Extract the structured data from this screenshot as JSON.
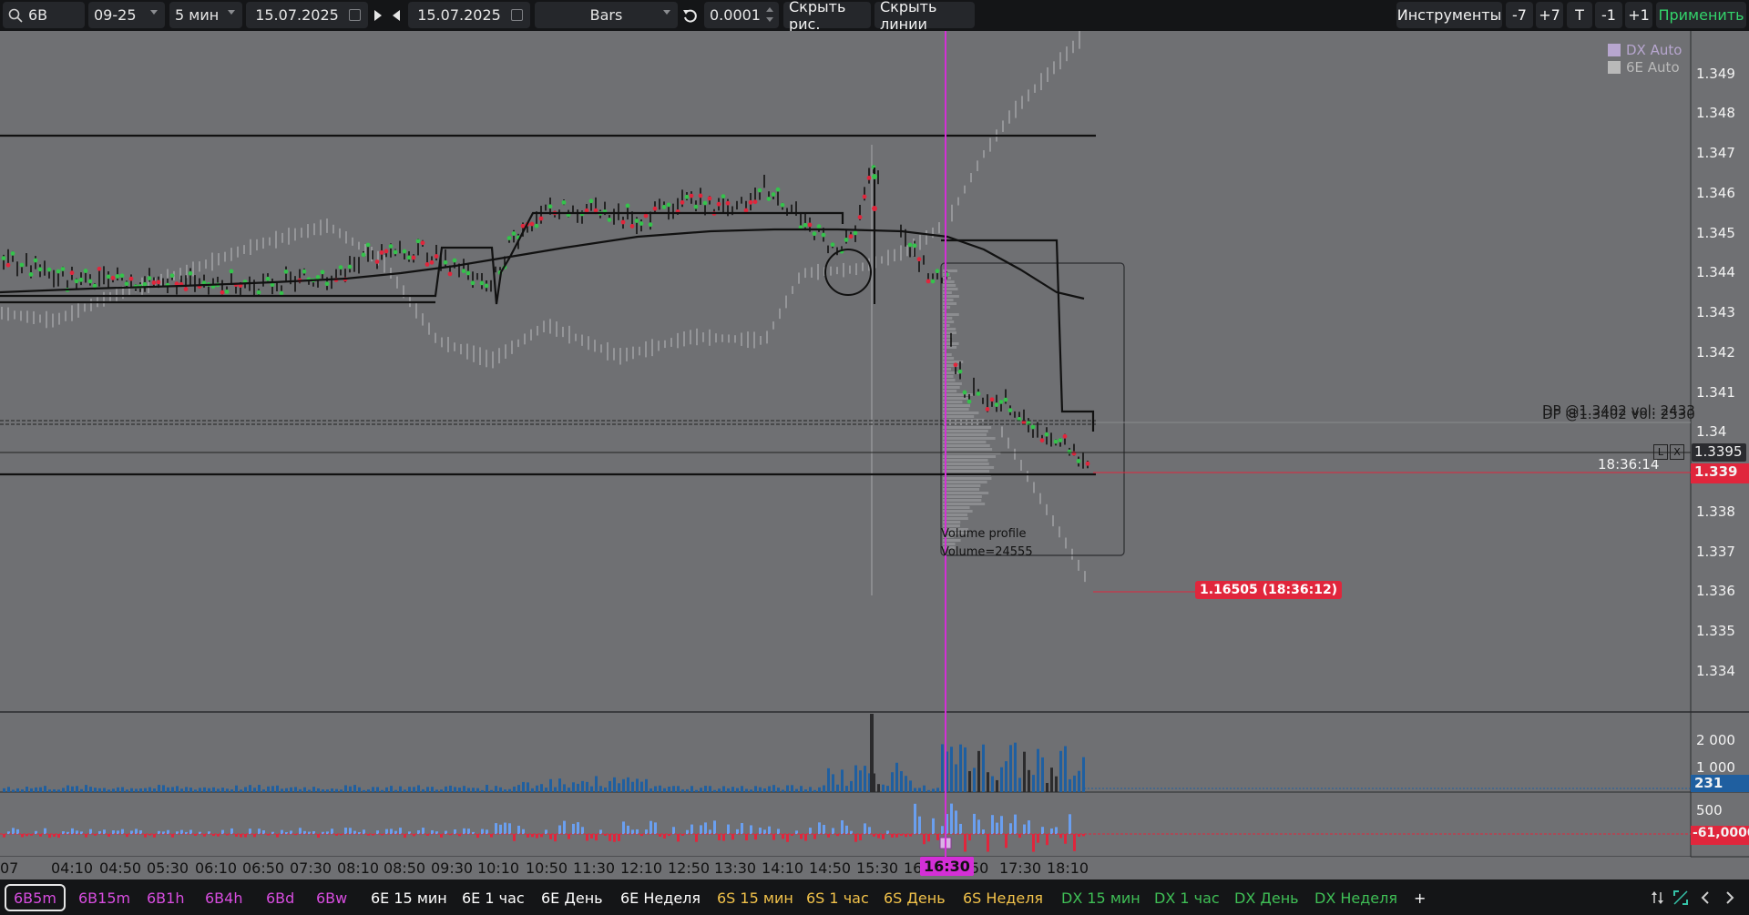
{
  "toolbar": {
    "symbol": "6B",
    "contract": "09-25",
    "timeframe": "5 мин",
    "date_from": "15.07.2025",
    "date_to": "15.07.2025",
    "chart_type": "Bars",
    "tick_size": "0.0001",
    "hide_drawings_label": "Скрыть рис.",
    "hide_lines_label": "Скрыть линии",
    "instruments_label": "Инструменты",
    "minus7_label": "-7",
    "plus7_label": "+7",
    "t_label": "T",
    "minus1_label": "-1",
    "plus1_label": "+1",
    "apply_label": "Применить"
  },
  "chart": {
    "legend": [
      {
        "label": "DX Auto",
        "color": "#b7a6cf"
      },
      {
        "label": "6E Auto",
        "color": "#b9b9b9"
      }
    ],
    "price_labels": [
      "1.349",
      "1.348",
      "1.347",
      "1.346",
      "1.345",
      "1.344",
      "1.343",
      "1.342",
      "1.341",
      "1.34",
      "1.3395",
      "1.339",
      "1.338",
      "1.337",
      "1.336",
      "1.335",
      "1.334"
    ],
    "current_price": "1.339",
    "current_price_color": "#e0263c",
    "countdown": "18:36:14",
    "dp_label_1": "DP @1.3402 vol: 2433",
    "dp_label_2": "DP @1.3402 vol: 2530",
    "volume_profile_title": "Volume profile",
    "volume_profile_value": "Volume=24555",
    "overlay_price_label": "1.16505 (18:36:12)",
    "overlay_label_color": "#e0263c",
    "line_marker_l": "L",
    "line_marker_x": "X",
    "volume_axis_labels": [
      "2 000",
      "1 000",
      "500"
    ],
    "volume_current": "231",
    "volume_current_color": "#1f5fa0",
    "delta_current": "-61,0000",
    "delta_current_color": "#e0263c"
  },
  "time_axis": {
    "labels": [
      "07",
      "04:10",
      "04:50",
      "05:30",
      "06:10",
      "06:50",
      "07:30",
      "08:10",
      "08:50",
      "09:30",
      "10:10",
      "10:50",
      "11:30",
      "12:10",
      "12:50",
      "13:30",
      "14:10",
      "14:50",
      "15:30",
      "16",
      "50",
      "17:30",
      "18:10"
    ],
    "highlight": "16:30",
    "highlight_color": "#d42fd6"
  },
  "tabs": [
    {
      "label": "6B5m",
      "color": "#d84de0",
      "active": true
    },
    {
      "label": "6B15m",
      "color": "#d84de0"
    },
    {
      "label": "6B1h",
      "color": "#d84de0"
    },
    {
      "label": "6B4h",
      "color": "#d84de0"
    },
    {
      "label": "6Bd",
      "color": "#d84de0"
    },
    {
      "label": "6Bw",
      "color": "#d84de0"
    },
    {
      "label": "6E 15 мин",
      "color": "#ffffff"
    },
    {
      "label": "6E 1 час",
      "color": "#ffffff"
    },
    {
      "label": "6E День",
      "color": "#ffffff"
    },
    {
      "label": "6E Неделя",
      "color": "#ffffff"
    },
    {
      "label": "6S 15 мин",
      "color": "#f2c24a"
    },
    {
      "label": "6S 1 час",
      "color": "#f2c24a"
    },
    {
      "label": "6S День",
      "color": "#f2c24a"
    },
    {
      "label": "6S Неделя",
      "color": "#f2c24a"
    },
    {
      "label": "DX 15 мин",
      "color": "#3fbf56"
    },
    {
      "label": "DX 1 час",
      "color": "#3fbf56"
    },
    {
      "label": "DX День",
      "color": "#3fbf56"
    },
    {
      "label": "DX Неделя",
      "color": "#3fbf56"
    },
    {
      "label": "+",
      "color": "#ffffff"
    }
  ]
}
